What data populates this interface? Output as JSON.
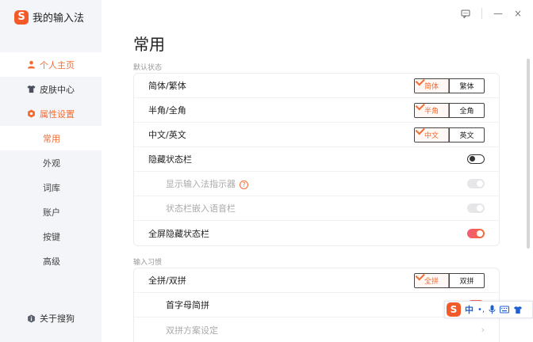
{
  "app": {
    "name": "我的输入法"
  },
  "window": {
    "feedback_icon": "feedback-icon",
    "minimize": "—",
    "close": "×"
  },
  "sidebar": {
    "items": [
      {
        "label": "个人主页",
        "icon": "person-icon"
      },
      {
        "label": "皮肤中心",
        "icon": "shirt-icon"
      },
      {
        "label": "属性设置",
        "icon": "settings-icon"
      }
    ],
    "sub_items": [
      "常用",
      "外观",
      "词库",
      "账户",
      "按键",
      "高级"
    ],
    "about": "关于搜狗"
  },
  "main": {
    "title": "常用",
    "section1": {
      "label": "默认状态",
      "rows": [
        {
          "label": "简体/繁体",
          "options": [
            "简体",
            "繁体"
          ],
          "selected": "简体"
        },
        {
          "label": "半角/全角",
          "options": [
            "半角",
            "全角"
          ],
          "selected": "半角"
        },
        {
          "label": "中文/英文",
          "options": [
            "中文",
            "英文"
          ],
          "selected": "中文"
        },
        {
          "label": "隐藏状态栏",
          "toggle": "off"
        },
        {
          "label": "显示输入法指示器",
          "help": "?",
          "toggle": "disabled"
        },
        {
          "label": "状态栏嵌入语音栏",
          "toggle": "disabled"
        },
        {
          "label": "全屏隐藏状态栏",
          "toggle": "on"
        }
      ]
    },
    "section2": {
      "label": "输入习惯",
      "rows": [
        {
          "label": "全拼/双拼",
          "options": [
            "全拼",
            "双拼"
          ],
          "selected": "全拼"
        },
        {
          "label": "首字母简拼",
          "toggle": "on"
        },
        {
          "label": "双拼方案设定",
          "chevron": "›"
        }
      ]
    }
  },
  "ime_bar": {
    "mode": "中",
    "punct": "•,",
    "icons": [
      "mic-icon",
      "keyboard-icon",
      "shirt-icon"
    ]
  },
  "colors": {
    "accent": "#f36c32",
    "sidebar_bg": "#f4f5f9",
    "ime_blue": "#1f5fd6"
  }
}
